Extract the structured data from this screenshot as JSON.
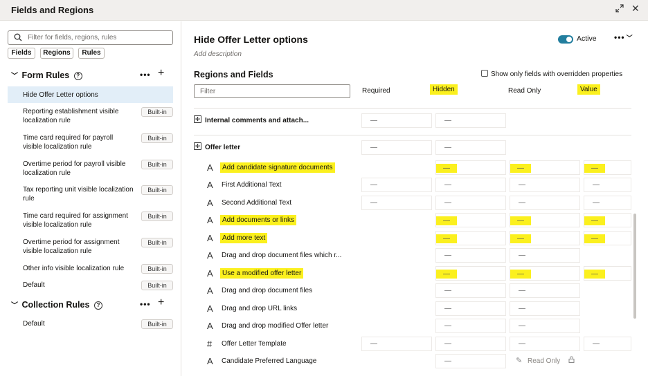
{
  "window": {
    "title": "Fields and Regions"
  },
  "left": {
    "search_placeholder": "Filter for fields, regions, rules",
    "chips": [
      "Fields",
      "Regions",
      "Rules"
    ],
    "form_rules_title": "Form Rules",
    "collection_rules_title": "Collection Rules",
    "more_label": "•••",
    "add_label": "+",
    "form_rules": [
      {
        "label": "Hide Offer Letter options",
        "badge": ""
      },
      {
        "label": "Reporting establishment visible localization rule",
        "badge": "Built-in"
      },
      {
        "label": "Time card required for payroll visible localization rule",
        "badge": "Built-in"
      },
      {
        "label": "Overtime period for payroll visible localization rule",
        "badge": "Built-in"
      },
      {
        "label": "Tax reporting unit visible localization rule",
        "badge": "Built-in"
      },
      {
        "label": "Time card required for assignment visible localization rule",
        "badge": "Built-in"
      },
      {
        "label": "Overtime period for assignment visible localization rule",
        "badge": "Built-in"
      },
      {
        "label": "Other info visible localization rule",
        "badge": "Built-in"
      },
      {
        "label": "Default",
        "badge": "Built-in"
      }
    ],
    "collection_rules": [
      {
        "label": "Default",
        "badge": "Built-in"
      }
    ]
  },
  "right": {
    "title": "Hide Offer Letter options",
    "add_description": "Add description",
    "active_label": "Active",
    "more_label": "•••",
    "regions_fields_title": "Regions and Fields",
    "show_overridden_label": "Show only fields with overridden properties",
    "filter_placeholder": "Filter",
    "columns": {
      "required": "Required",
      "hidden": "Hidden",
      "read_only": "Read Only",
      "value": "Value"
    },
    "dash": "—",
    "read_only_text": "Read Only",
    "groups": [
      {
        "name": "Internal comments and attach..."
      },
      {
        "name": "Offer letter"
      }
    ],
    "fields": [
      {
        "name": "Add candidate signature documents",
        "highlight": true
      },
      {
        "name": "First Additional Text",
        "highlight": false
      },
      {
        "name": "Second Additional Text",
        "highlight": false
      },
      {
        "name": "Add documents or links",
        "highlight": true
      },
      {
        "name": "Add more text",
        "highlight": true
      },
      {
        "name": "Drag and drop document files which r...",
        "highlight": false
      },
      {
        "name": "Use a modified offer letter",
        "highlight": true
      },
      {
        "name": "Drag and drop document files",
        "highlight": false
      },
      {
        "name": "Drag and drop URL links",
        "highlight": false
      },
      {
        "name": "Drag and drop modified Offer letter",
        "highlight": false
      },
      {
        "name": "Offer Letter Template",
        "highlight": false
      },
      {
        "name": "Candidate Preferred Language",
        "highlight": false
      }
    ]
  },
  "colors": {
    "highlight": "#fbf01e",
    "toggle": "#227e9e",
    "selected": "#e2eef8"
  }
}
